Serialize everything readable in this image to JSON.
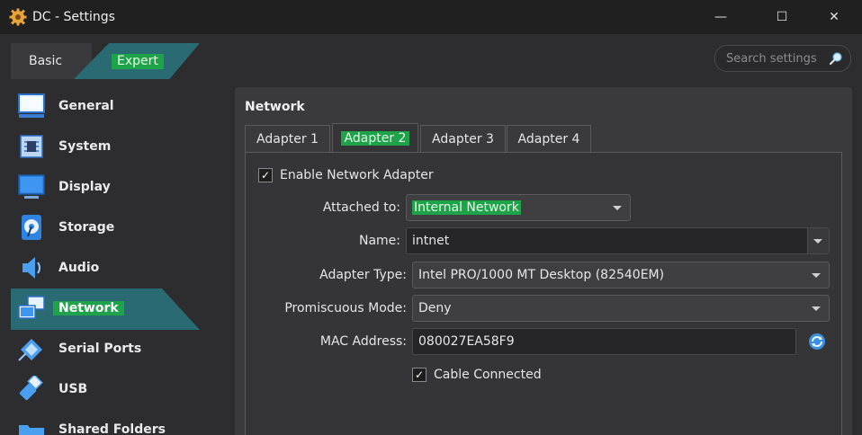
{
  "window": {
    "title": "DC - Settings",
    "min_glyph": "—",
    "max_glyph": "☐",
    "close_glyph": "✕"
  },
  "mode": {
    "basic": "Basic",
    "expert": "Expert"
  },
  "search": {
    "placeholder": "Search settings"
  },
  "sidebar": {
    "items": [
      {
        "label": "General"
      },
      {
        "label": "System"
      },
      {
        "label": "Display"
      },
      {
        "label": "Storage"
      },
      {
        "label": "Audio"
      },
      {
        "label": "Network",
        "active": true
      },
      {
        "label": "Serial Ports"
      },
      {
        "label": "USB"
      },
      {
        "label": "Shared Folders"
      }
    ]
  },
  "panel": {
    "title": "Network",
    "tabs": [
      {
        "label": "Adapter 1"
      },
      {
        "label": "Adapter 2",
        "active": true
      },
      {
        "label": "Adapter 3"
      },
      {
        "label": "Adapter 4"
      }
    ],
    "enable_adapter": {
      "label": "Enable Network Adapter",
      "checked": true,
      "mark": "✓"
    },
    "attached_to": {
      "label": "Attached to:",
      "value": "Internal Network"
    },
    "name": {
      "label": "Name:",
      "value": "intnet"
    },
    "adapter_type": {
      "label": "Adapter Type:",
      "value": "Intel PRO/1000 MT Desktop (82540EM)"
    },
    "promiscuous_mode": {
      "label": "Promiscuous Mode:",
      "value": "Deny"
    },
    "mac_address": {
      "label": "MAC Address:",
      "value": "080027EA58F9"
    },
    "cable_connected": {
      "label": "Cable Connected",
      "checked": true,
      "mark": "✓"
    }
  },
  "colors": {
    "accent_highlight": "#1ea34a",
    "selection_teal": "#2a6a73",
    "panel_bg": "#3a3a3d"
  }
}
